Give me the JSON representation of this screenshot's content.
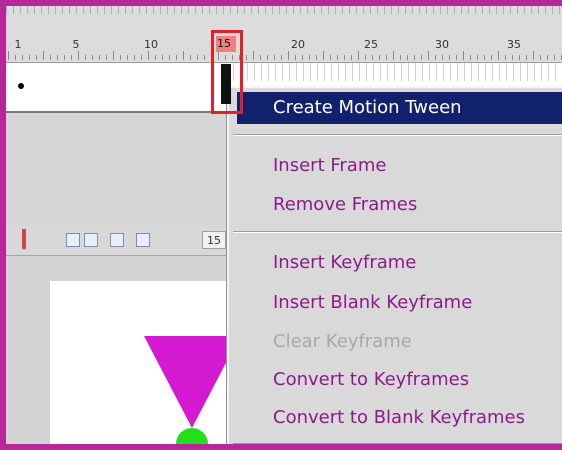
{
  "timeline": {
    "ruler_numbers": [
      "1",
      "5",
      "10",
      "15",
      "20",
      "25",
      "30",
      "35"
    ],
    "current_frame": "15"
  },
  "toolbar": {
    "frame_number": "15"
  },
  "context_menu": {
    "items": [
      {
        "label": "Create Motion Tween",
        "state": "highlighted"
      },
      {
        "label": "Insert Frame",
        "state": "enabled"
      },
      {
        "label": "Remove Frames",
        "state": "enabled"
      },
      {
        "label": "Insert Keyframe",
        "state": "enabled"
      },
      {
        "label": "Insert Blank Keyframe",
        "state": "enabled"
      },
      {
        "label": "Clear Keyframe",
        "state": "disabled"
      },
      {
        "label": "Convert to Keyframes",
        "state": "enabled"
      },
      {
        "label": "Convert to Blank Keyframes",
        "state": "enabled"
      }
    ]
  },
  "colors": {
    "border": "#b8279a",
    "menu_text": "#8c1a8a",
    "highlight_bg": "#12216e",
    "playhead_outline": "#e2202a",
    "shape_magenta": "#d41ad0",
    "shape_green": "#22e01c"
  }
}
